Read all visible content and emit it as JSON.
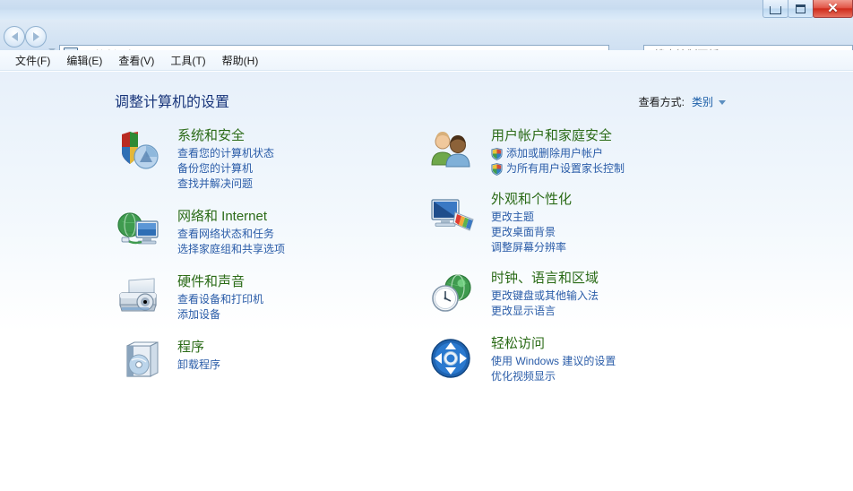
{
  "titlebar": {
    "minimize_label": "",
    "maximize_label": "",
    "close_label": "✕"
  },
  "navbar": {
    "back_icon": "back-arrow-icon",
    "forward_icon": "forward-arrow-icon",
    "breadcrumb": "控制面板",
    "refresh_label": "↯",
    "search_placeholder": "搜索控制面板",
    "search_value": "",
    "search_icon": "⌕"
  },
  "menubar": {
    "items": [
      {
        "label": "文件(F)"
      },
      {
        "label": "编辑(E)"
      },
      {
        "label": "查看(V)"
      },
      {
        "label": "工具(T)"
      },
      {
        "label": "帮助(H)"
      }
    ]
  },
  "header": {
    "title": "调整计算机的设置",
    "view_by_label": "查看方式:",
    "view_by_value": "类别"
  },
  "colors": {
    "category_title": "#2b6b17",
    "link": "#2a5ca8",
    "page_title": "#18357a",
    "close_button": "#cf2c1c"
  },
  "categories": {
    "left": [
      {
        "icon": "shield-and-chart-icon",
        "title": "系统和安全",
        "links": [
          {
            "label": "查看您的计算机状态",
            "shield": false
          },
          {
            "label": "备份您的计算机",
            "shield": false
          },
          {
            "label": "查找并解决问题",
            "shield": false
          }
        ]
      },
      {
        "icon": "network-globe-monitor-icon",
        "title": "网络和 Internet",
        "links": [
          {
            "label": "查看网络状态和任务",
            "shield": false
          },
          {
            "label": "选择家庭组和共享选项",
            "shield": false
          }
        ]
      },
      {
        "icon": "printer-speaker-icon",
        "title": "硬件和声音",
        "links": [
          {
            "label": "查看设备和打印机",
            "shield": false
          },
          {
            "label": "添加设备",
            "shield": false
          }
        ]
      },
      {
        "icon": "programs-cd-box-icon",
        "title": "程序",
        "links": [
          {
            "label": "卸载程序",
            "shield": false
          }
        ]
      }
    ],
    "right": [
      {
        "icon": "user-accounts-people-icon",
        "title": "用户帐户和家庭安全",
        "links": [
          {
            "label": "添加或删除用户帐户",
            "shield": true
          },
          {
            "label": "为所有用户设置家长控制",
            "shield": true
          }
        ]
      },
      {
        "icon": "appearance-monitor-palette-icon",
        "title": "外观和个性化",
        "links": [
          {
            "label": "更改主题",
            "shield": false
          },
          {
            "label": "更改桌面背景",
            "shield": false
          },
          {
            "label": "调整屏幕分辨率",
            "shield": false
          }
        ]
      },
      {
        "icon": "clock-globe-icon",
        "title": "时钟、语言和区域",
        "links": [
          {
            "label": "更改键盘或其他输入法",
            "shield": false
          },
          {
            "label": "更改显示语言",
            "shield": false
          }
        ]
      },
      {
        "icon": "ease-of-access-icon",
        "title": "轻松访问",
        "links": [
          {
            "label": "使用 Windows 建议的设置",
            "shield": false
          },
          {
            "label": "优化视频显示",
            "shield": false
          }
        ]
      }
    ]
  }
}
